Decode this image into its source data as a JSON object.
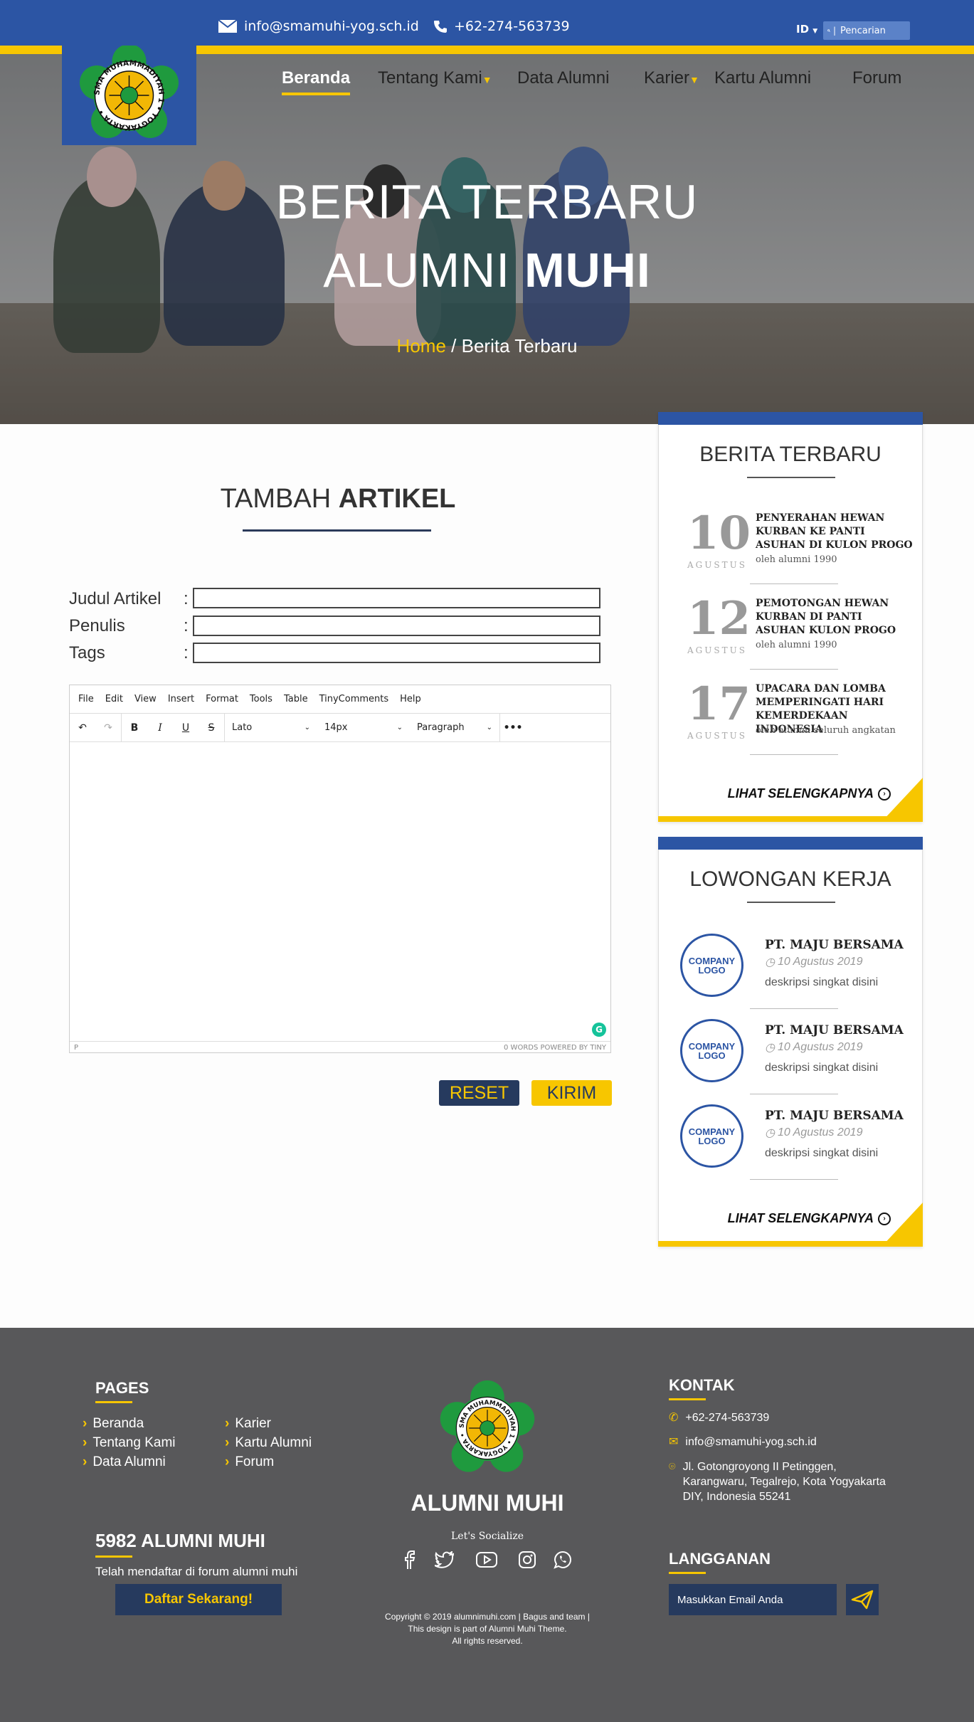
{
  "topbar": {
    "email": "info@smamuhi-yog.sch.id",
    "phone": "+62-274-563739",
    "lang": "ID",
    "search_placeholder": "Pencarian"
  },
  "logo": {
    "ring_text": "SMA MUHAMMADIYAH 1 • YOGYAKARTA •",
    "colors": {
      "petal": "#1f9a3e",
      "ring": "#ffffff",
      "sun": "#f2b705"
    }
  },
  "nav": {
    "items": [
      {
        "label": "Beranda",
        "active": true
      },
      {
        "label": "Tentang Kami",
        "has_dropdown": true
      },
      {
        "label": "Data Alumni"
      },
      {
        "label": "Karier",
        "has_dropdown": true
      },
      {
        "label": "Kartu Alumni"
      },
      {
        "label": "Forum"
      }
    ]
  },
  "hero": {
    "title_line1": "BERITA TERBARU",
    "title_line2_regular": "ALUMNI",
    "title_line2_bold": "MUHI",
    "breadcrumb_home": "Home",
    "breadcrumb_sep": "/",
    "breadcrumb_current": "Berita Terbaru"
  },
  "form": {
    "title_regular": "TAMBAH",
    "title_bold": "ARTIKEL",
    "fields": [
      {
        "label": "Judul Artikel",
        "colon": ":",
        "value": ""
      },
      {
        "label": "Penulis",
        "colon": ":",
        "value": ""
      },
      {
        "label": "Tags",
        "colon": ":",
        "value": ""
      }
    ],
    "editor": {
      "menu": [
        "File",
        "Edit",
        "View",
        "Insert",
        "Format",
        "Tools",
        "Table",
        "TinyComments",
        "Help"
      ],
      "font": "Lato",
      "size": "14px",
      "block": "Paragraph",
      "status_left": "P",
      "status_right": "0 WORDS  POWERED BY TINY"
    },
    "reset_label": "RESET",
    "submit_label": "KIRIM"
  },
  "sidebar": {
    "news": {
      "title": "BERITA TERBARU",
      "items": [
        {
          "day": "10",
          "month": "AGUSTUS",
          "title": "PENYERAHAN HEWAN KURBAN KE PANTI ASUHAN DI KULON PROGO",
          "author": "oleh alumni 1990"
        },
        {
          "day": "12",
          "month": "AGUSTUS",
          "title": "PEMOTONGAN HEWAN KURBAN DI PANTI ASUHAN KULON PROGO",
          "author": "oleh alumni 1990"
        },
        {
          "day": "17",
          "month": "AGUSTUS",
          "title": "UPACARA DAN LOMBA MEMPERINGATI HARI KEMERDEKAAN INDONESIA",
          "author": "oleh alumni seluruh angkatan"
        }
      ],
      "more": "LIHAT SELENGKAPNYA"
    },
    "jobs": {
      "title": "LOWONGAN KERJA",
      "items": [
        {
          "logo": "COMPANY LOGO",
          "company": "PT. MAJU BERSAMA",
          "date": "10 Agustus 2019",
          "desc": "deskripsi singkat disini"
        },
        {
          "logo": "COMPANY LOGO",
          "company": "PT. MAJU BERSAMA",
          "date": "10 Agustus 2019",
          "desc": "deskripsi singkat disini"
        },
        {
          "logo": "COMPANY LOGO",
          "company": "PT. MAJU BERSAMA",
          "date": "10 Agustus 2019",
          "desc": "deskripsi singkat disini"
        }
      ],
      "more": "LIHAT SELENGKAPNYA"
    }
  },
  "footer": {
    "pages_title": "PAGES",
    "pages_col1": [
      "Beranda",
      "Tentang Kami",
      "Data Alumni"
    ],
    "pages_col2": [
      "Karier",
      "Kartu Alumni",
      "Forum"
    ],
    "count_title": "5982 ALUMNI MUHI",
    "count_text": "Telah mendaftar di forum alumni muhi",
    "signup_label": "Daftar Sekarang!",
    "brand": "ALUMNI MUHI",
    "socialize": "Let's Socialize",
    "social_icons": [
      "facebook-icon",
      "twitter-icon",
      "youtube-icon",
      "instagram-icon",
      "whatsapp-icon"
    ],
    "copyright_1": "Copyright © 2019 alumnimuhi.com | Bagus and team |",
    "copyright_2": "This design is part of Alumni Muhi Theme.",
    "copyright_3": "All rights reserved.",
    "contact_title": "KONTAK",
    "contact_phone": "+62-274-563739",
    "contact_email": "info@smamuhi-yog.sch.id",
    "contact_address_1": "Jl. Gotongroyong II Petinggen,",
    "contact_address_2": "Karangwaru, Tegalrejo, Kota Yogyakarta",
    "contact_address_3": "DIY, Indonesia 55241",
    "subscribe_title": "LANGGANAN",
    "subscribe_placeholder": "Masukkan Email Anda"
  },
  "colors": {
    "primary_blue": "#2c55a4",
    "accent_yellow": "#f7c600",
    "navy": "#263a5e",
    "footer_bg": "#58585a"
  }
}
